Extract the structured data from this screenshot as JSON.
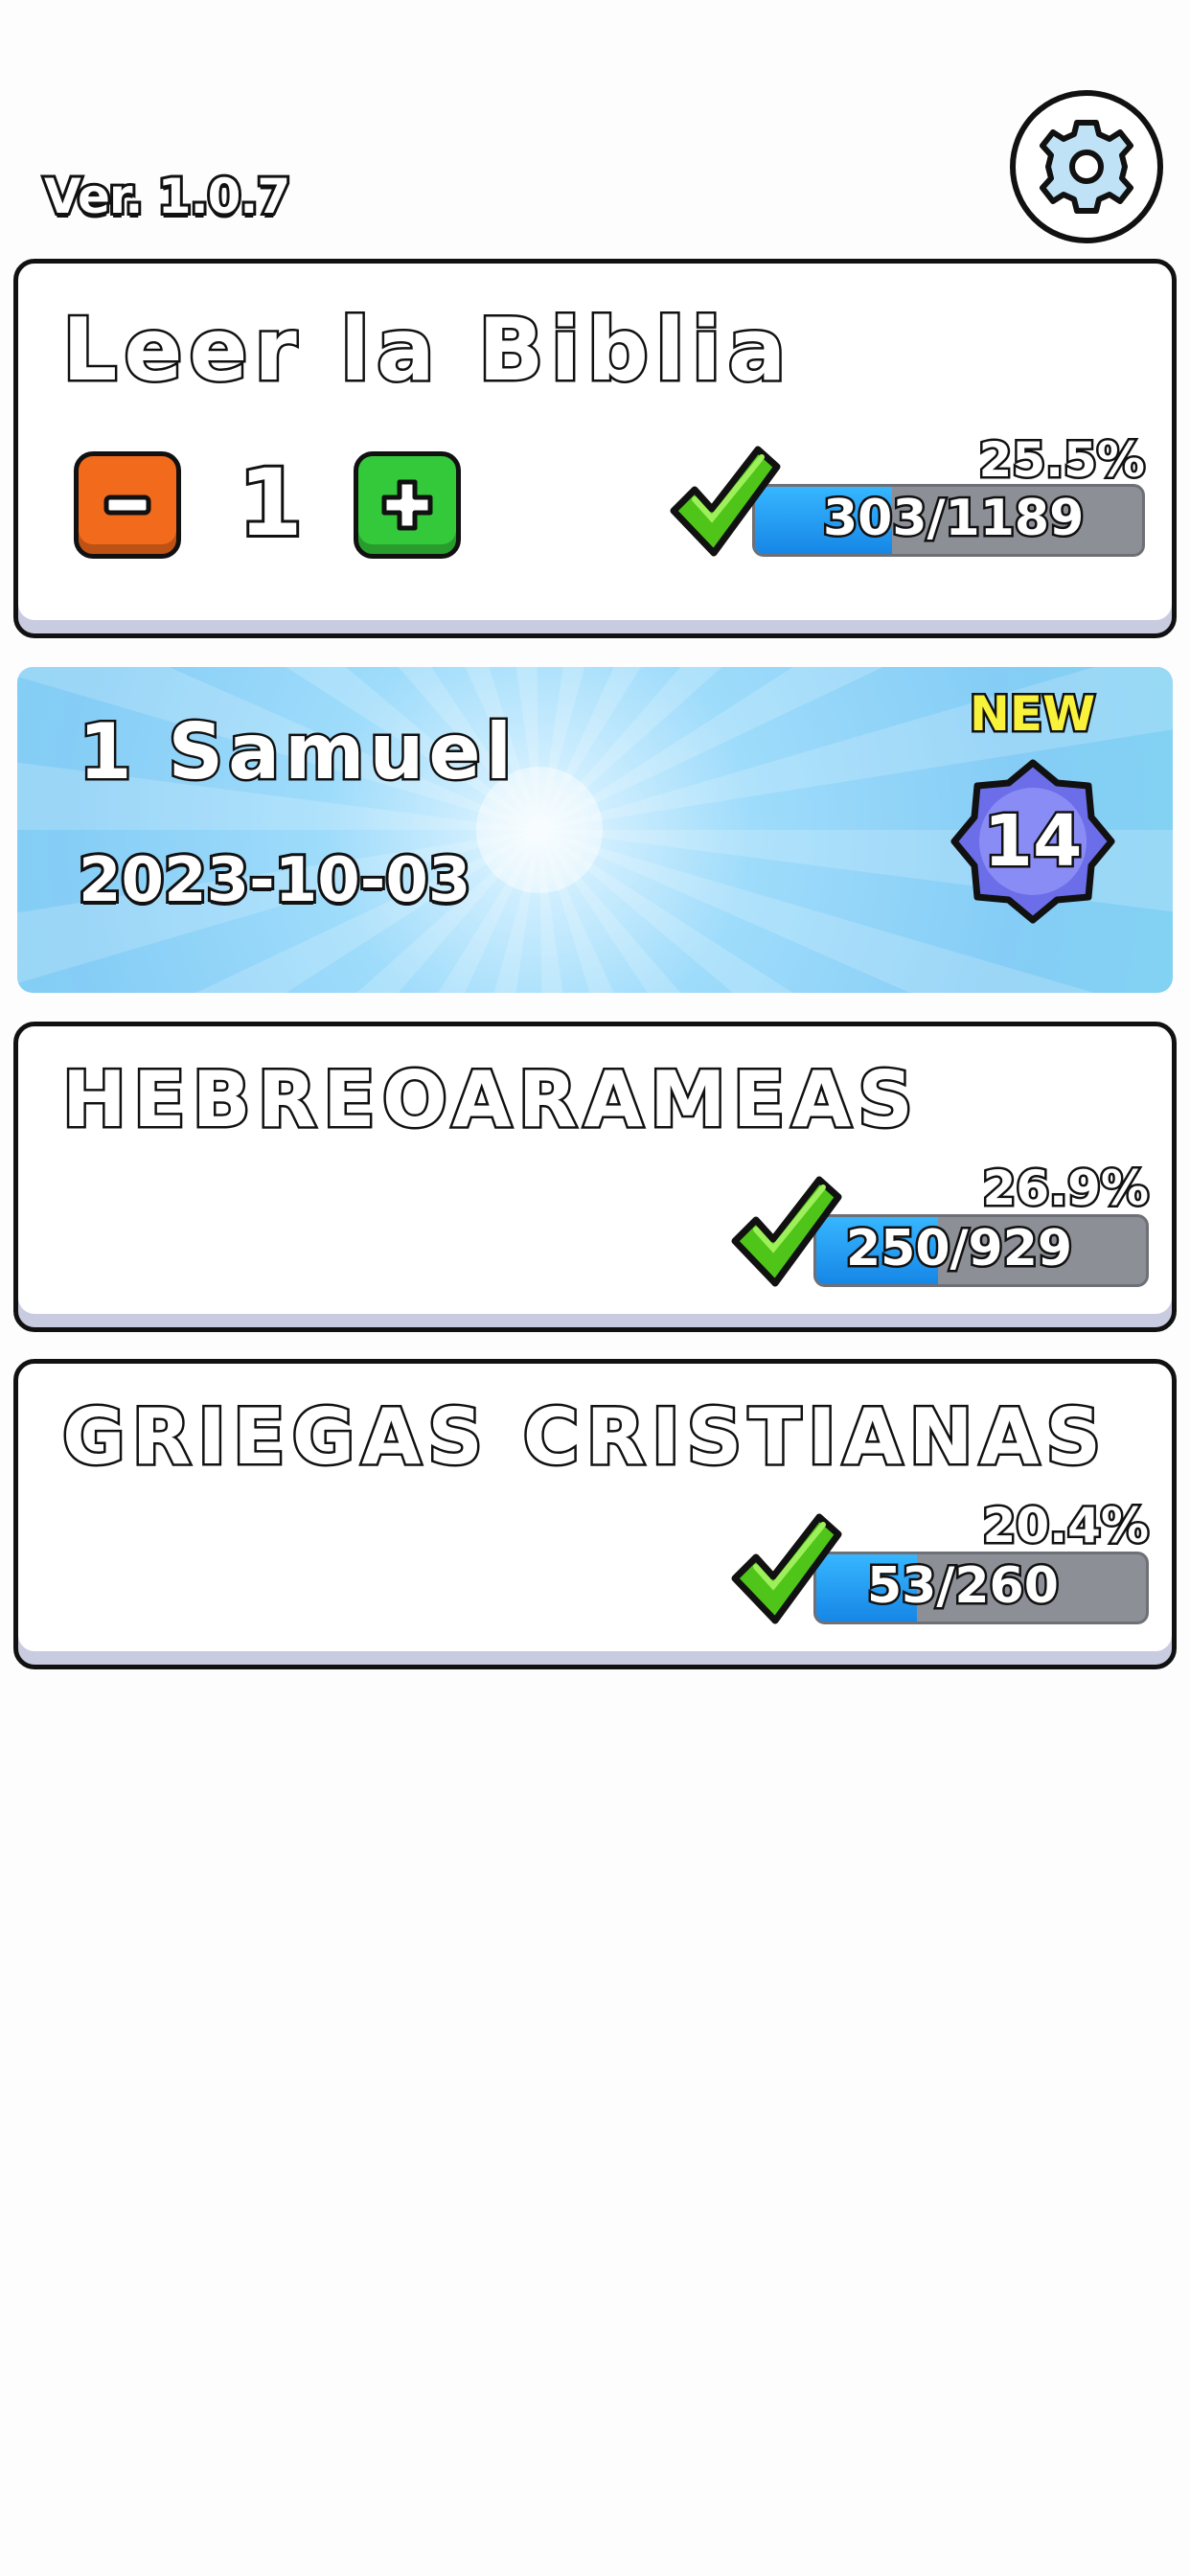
{
  "header": {
    "version": "Ver. 1.0.7",
    "settings_icon": "gear-icon"
  },
  "bible_card": {
    "title": "Leer la Biblia",
    "stepper": {
      "minus_label": "−",
      "value": "1",
      "plus_label": "+"
    },
    "progress": {
      "percent_text": "25.5%",
      "count_text": "303/1189",
      "fraction": 0.255
    }
  },
  "banner": {
    "book": "1 Samuel",
    "date": "2023-10-03",
    "new_label": "NEW",
    "badge_number": "14"
  },
  "sections": [
    {
      "title": "HEBREOARAMEAS",
      "progress": {
        "percent_text": "26.9%",
        "count_text": "250/929",
        "fraction": 0.269
      }
    },
    {
      "title": "GRIEGAS CRISTIANAS",
      "progress": {
        "percent_text": "20.4%",
        "count_text": "53/260",
        "fraction": 0.204
      }
    }
  ],
  "colors": {
    "minus": "#f26a1b",
    "plus": "#34c93a",
    "progress_fill": "#1686e6",
    "progress_track": "#8c8f96",
    "check": "#4fc51a",
    "badge": "#6b6ee8",
    "new_label": "#f8f23a"
  }
}
